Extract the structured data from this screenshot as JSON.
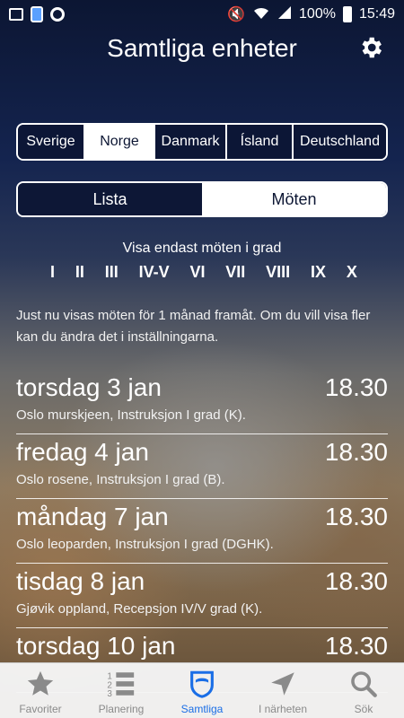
{
  "status_bar": {
    "battery": "100%",
    "time": "15:49"
  },
  "header": {
    "title": "Samtliga enheter"
  },
  "countries": [
    "Sverige",
    "Norge",
    "Danmark",
    "Ísland",
    "Deutschland"
  ],
  "countries_selected": "Norge",
  "view_toggle": {
    "list_label": "Lista",
    "meetings_label": "Möten"
  },
  "grade_filter": {
    "label": "Visa endast möten i grad",
    "grades": [
      "I",
      "II",
      "III",
      "IV-V",
      "VI",
      "VII",
      "VIII",
      "IX",
      "X"
    ]
  },
  "info_text": "Just nu visas möten för 1 månad framåt. Om du vill visa fler kan du ändra det i inställningarna.",
  "meetings": [
    {
      "day": "torsdag 3 jan",
      "time": "18.30",
      "desc": "Oslo murskjeen, Instruksjon I grad (K)."
    },
    {
      "day": "fredag 4 jan",
      "time": "18.30",
      "desc": "Oslo rosene, Instruksjon I grad (B)."
    },
    {
      "day": "måndag 7 jan",
      "time": "18.30",
      "desc": "Oslo leoparden, Instruksjon I grad (DGHK)."
    },
    {
      "day": "tisdag 8 jan",
      "time": "18.30",
      "desc": "Gjøvik oppland, Recepsjon IV/V grad (K)."
    },
    {
      "day": "torsdag 10 jan",
      "time": "18.30",
      "desc": ""
    }
  ],
  "tabs": [
    {
      "label": "Favoriter",
      "icon": "star-icon"
    },
    {
      "label": "Planering",
      "icon": "numbered-list-icon"
    },
    {
      "label": "Samtliga",
      "icon": "shield-icon"
    },
    {
      "label": "I närheten",
      "icon": "location-arrow-icon"
    },
    {
      "label": "Sök",
      "icon": "search-icon"
    }
  ],
  "colors": {
    "accent": "#1a6ee6",
    "dark_navy": "#0c1633"
  }
}
